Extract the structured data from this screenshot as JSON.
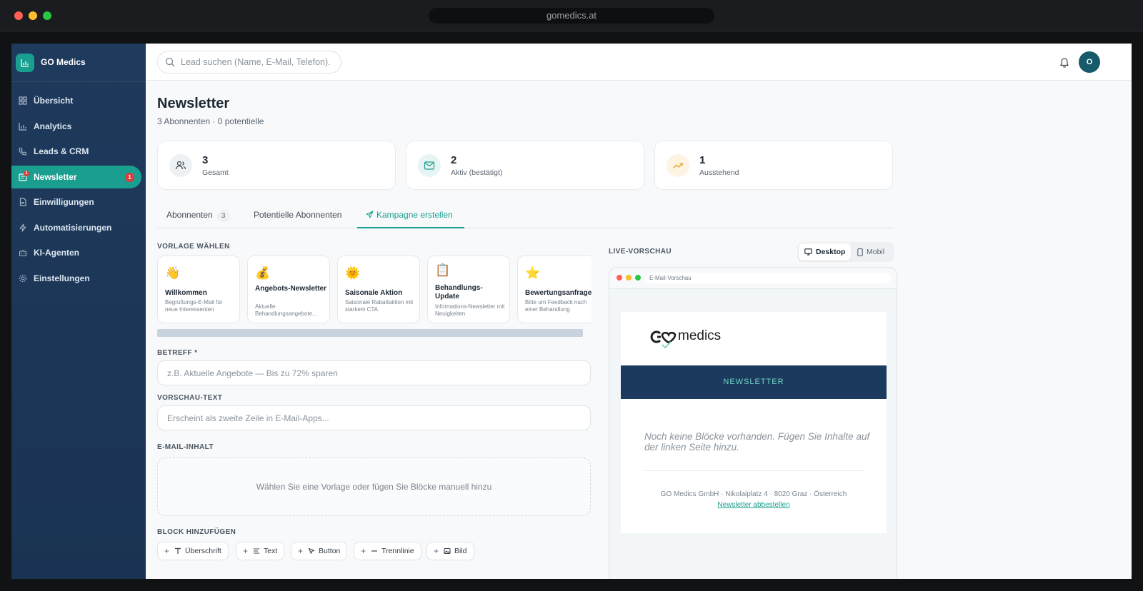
{
  "window": {
    "url": "gomedics.at"
  },
  "sidebar": {
    "brand": "GO Medics",
    "items": [
      {
        "label": "Übersicht",
        "icon": "grid-icon"
      },
      {
        "label": "Analytics",
        "icon": "bar-chart-icon"
      },
      {
        "label": "Leads & CRM",
        "icon": "phone-icon"
      },
      {
        "label": "Newsletter",
        "icon": "newsletter-icon",
        "badge": "1",
        "active": true
      },
      {
        "label": "Einwilligungen",
        "icon": "document-icon"
      },
      {
        "label": "Automatisierungen",
        "icon": "lightning-icon"
      },
      {
        "label": "KI-Agenten",
        "icon": "bot-icon"
      },
      {
        "label": "Einstellungen",
        "icon": "gear-icon"
      }
    ]
  },
  "topbar": {
    "search_placeholder": "Lead suchen (Name, E-Mail, Telefon).",
    "avatar": "O"
  },
  "page": {
    "title": "Newsletter",
    "subtitle": "3 Abonnenten · 0 potentielle"
  },
  "stats": [
    {
      "value": "3",
      "label": "Gesamt",
      "icon": "users-icon"
    },
    {
      "value": "2",
      "label": "Aktiv (bestätigt)",
      "icon": "mail-icon"
    },
    {
      "value": "1",
      "label": "Ausstehend",
      "icon": "trending-up-icon"
    }
  ],
  "tabs": [
    {
      "label": "Abonnenten",
      "count": "3"
    },
    {
      "label": "Potentielle Abonnenten"
    },
    {
      "label": "Kampagne erstellen",
      "active": true
    }
  ],
  "templates": {
    "section_label": "VORLAGE WÄHLEN",
    "items": [
      {
        "emoji": "👋",
        "name": "Willkommen",
        "desc": "Begrüßungs-E-Mail für neue Interessenten"
      },
      {
        "emoji": "💰",
        "name": "Angebots-Newsletter",
        "desc": "Aktuelle Behandlungsangebote..."
      },
      {
        "emoji": "🌞",
        "name": "Saisonale Aktion",
        "desc": "Saisonale Rabattaktion mit starkem CTA"
      },
      {
        "emoji": "📋",
        "name": "Behandlungs-Update",
        "desc": "Informations-Newsletter mit Neuigkeiten"
      },
      {
        "emoji": "⭐",
        "name": "Bewertungsanfrage",
        "desc": "Bitte um Feedback nach einer Behandlung"
      }
    ]
  },
  "form": {
    "subject_label": "BETREFF *",
    "subject_placeholder": "z.B. Aktuelle Angebote — Bis zu 72% sparen",
    "preview_label": "VORSCHAU-TEXT",
    "preview_placeholder": "Erscheint als zweite Zeile in E-Mail-Apps...",
    "content_label": "E-MAIL-INHALT",
    "dropzone_text": "Wählen Sie eine Vorlage oder fügen Sie Blöcke manuell hinzu",
    "blocks_label": "BLOCK HINZUFÜGEN",
    "blocks": [
      "Überschrift",
      "Text",
      "Button",
      "Trennlinie",
      "Bild"
    ]
  },
  "preview": {
    "label": "LIVE-VORSCHAU",
    "desktop": "Desktop",
    "mobile": "Mobil",
    "browser_url": "E-Mail-Vorschau",
    "logo_text": "medics",
    "band_text": "NEWSLETTER",
    "empty_text": "Noch keine Blöcke vorhanden. Fügen Sie Inhalte auf der linken Seite hinzu.",
    "footer": "GO Medics GmbH · Nikolaiplatz 4 · 8020 Graz · Österreich",
    "unsubscribe": "Newsletter abbestellen"
  },
  "colors": {
    "accent": "#1a9e8f",
    "sidebar": "#1e3a5c",
    "badge": "#e03b3b",
    "band": "#1c3a5e"
  }
}
